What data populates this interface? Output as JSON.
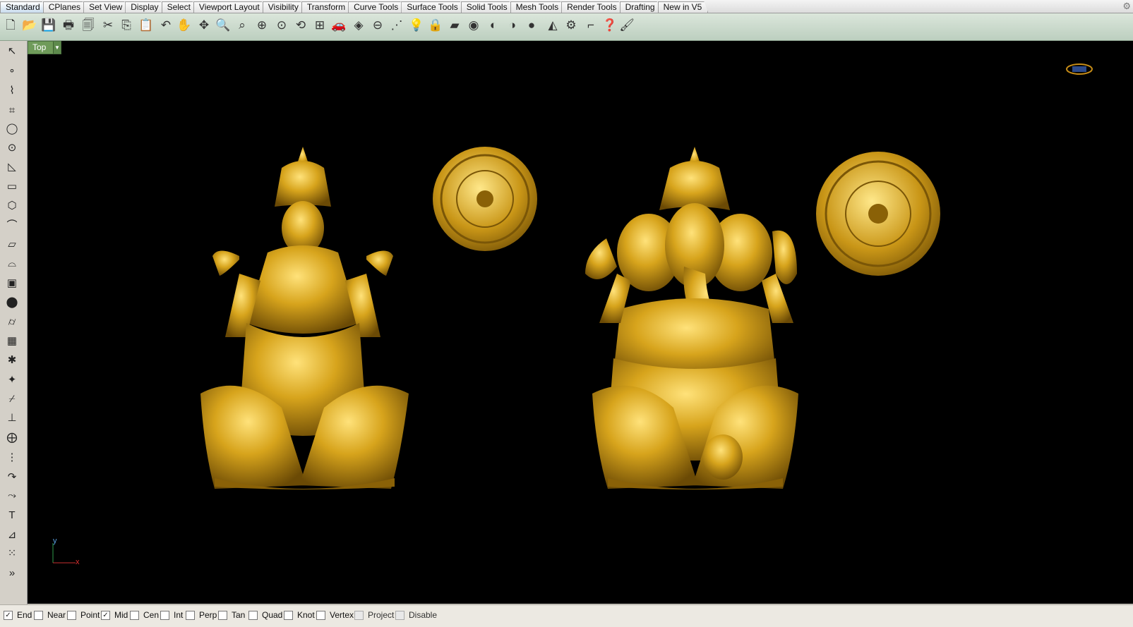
{
  "tabs": [
    "Standard",
    "CPlanes",
    "Set View",
    "Display",
    "Select",
    "Viewport Layout",
    "Visibility",
    "Transform",
    "Curve Tools",
    "Surface Tools",
    "Solid Tools",
    "Mesh Tools",
    "Render Tools",
    "Drafting",
    "New in V5"
  ],
  "active_tab": "Standard",
  "viewport": {
    "label": "Top"
  },
  "axes": {
    "x": "x",
    "y": "y"
  },
  "osnaps": [
    {
      "label": "End",
      "checked": true
    },
    {
      "label": "Near",
      "checked": false
    },
    {
      "label": "Point",
      "checked": false
    },
    {
      "label": "Mid",
      "checked": true
    },
    {
      "label": "Cen",
      "checked": false
    },
    {
      "label": "Int",
      "checked": false
    },
    {
      "label": "Perp",
      "checked": false
    },
    {
      "label": "Tan",
      "checked": false
    },
    {
      "label": "Quad",
      "checked": false
    },
    {
      "label": "Knot",
      "checked": false
    },
    {
      "label": "Vertex",
      "checked": false
    },
    {
      "label": "Project",
      "checked": false,
      "disabled": true
    },
    {
      "label": "Disable",
      "checked": false,
      "disabled": true
    }
  ],
  "colors": {
    "gold": "#d4a21a",
    "viewport_bg": "#000000",
    "toolbar_bg": "#c8d8ca"
  }
}
